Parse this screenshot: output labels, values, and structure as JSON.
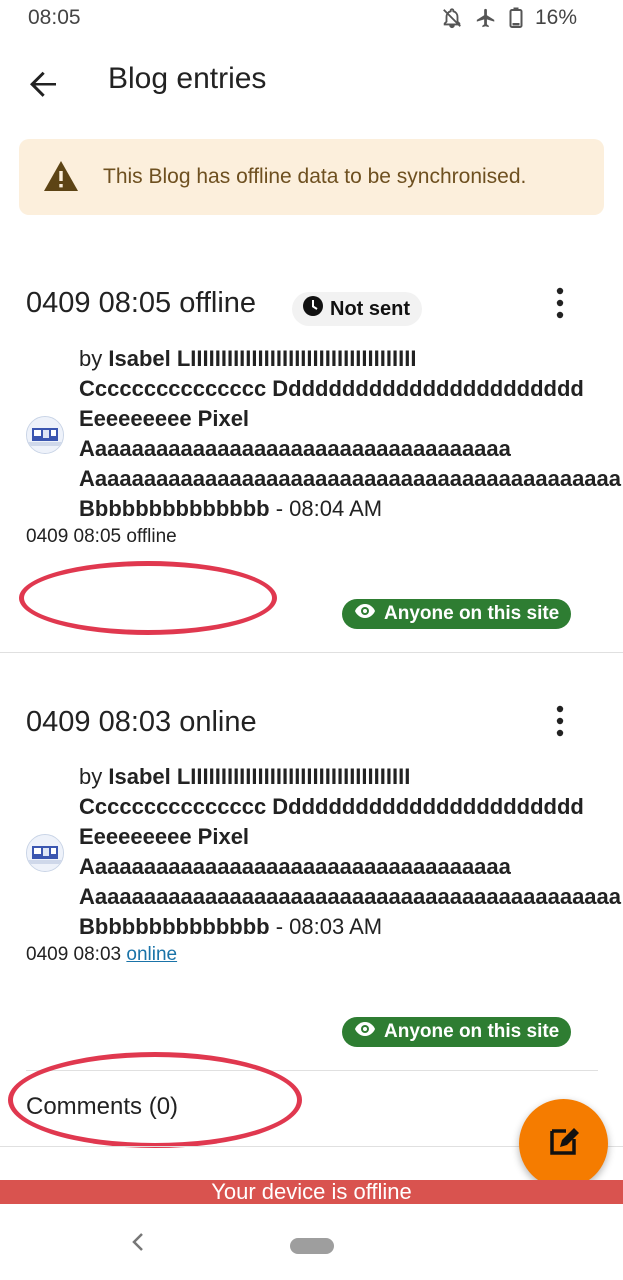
{
  "status": {
    "time": "08:05",
    "battery": "16%"
  },
  "appbar": {
    "title": "Blog entries"
  },
  "warning": {
    "text": "This Blog has offline data to be synchronised."
  },
  "entries": [
    {
      "title": "0409 08:05 offline",
      "status_badge": "Not sent",
      "author_prefix": "by ",
      "author_lines": [
        "Isabel LIIIIIIIIIIIIIIIIIIIIIIIIIIIIIIIIIIIII",
        "Ccccccccccccccc Ddddddddddddddddddddddd",
        "Eeeeeeeee Pixel",
        "Aaaaaaaaaaaaaaaaaaaaaaaaaaaaaaaaaaa",
        "Aaaaaaaaaaaaaaaaaaaaaaaaaaaaaaaaaaaaaaaaaaaa",
        "Bbbbbbbbbbbbbb"
      ],
      "time_suffix": " - 08:04 AM",
      "subject": "0409 08:05 offline",
      "subject_link": "",
      "visibility": "Anyone on this site"
    },
    {
      "title": "0409 08:03 online",
      "author_prefix": "by ",
      "author_lines": [
        "Isabel LIIIIIIIIIIIIIIIIIIIIIIIIIIIIIIIIIIII",
        "Ccccccccccccccc Ddddddddddddddddddddddd",
        "Eeeeeeeee Pixel",
        "Aaaaaaaaaaaaaaaaaaaaaaaaaaaaaaaaaaa",
        "Aaaaaaaaaaaaaaaaaaaaaaaaaaaaaaaaaaaaaaaaaaaa",
        "Bbbbbbbbbbbbbb"
      ],
      "time_suffix": " - 08:03 AM",
      "subject": "0409 08:03 ",
      "subject_link": "online",
      "visibility": "Anyone on this site",
      "comments": "Comments (0)"
    }
  ],
  "offline_banner": "Your device is offline",
  "colors": {
    "accent": "#f57c00",
    "badge_green": "#2e7d32",
    "offline_red": "#d9534f",
    "annotation_red": "#e0384f",
    "warning_bg": "#fcefdc"
  }
}
